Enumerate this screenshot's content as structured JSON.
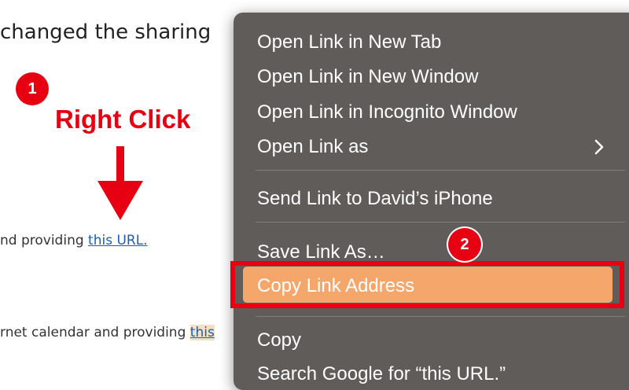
{
  "background": {
    "heading": "changed the sharing",
    "line1": {
      "prefix": "nd providing ",
      "link": "this URL."
    },
    "line2": {
      "prefix": "rnet calendar and providing ",
      "link": "this"
    }
  },
  "annotations": {
    "step1": "1",
    "step2": "2",
    "right_click_label": "Right Click",
    "accent_color": "#e60012"
  },
  "context_menu": {
    "items": [
      "Open Link in New Tab",
      "Open Link in New Window",
      "Open Link in Incognito Window",
      "Open Link as",
      "Send Link to David’s iPhone",
      "Save Link As…",
      "Copy Link Address",
      "Copy",
      "Search Google for “this URL.”"
    ],
    "submenu_icon": "chevron-right-icon",
    "highlighted_item": "Copy Link Address",
    "highlight_color": "#f5a76b"
  }
}
